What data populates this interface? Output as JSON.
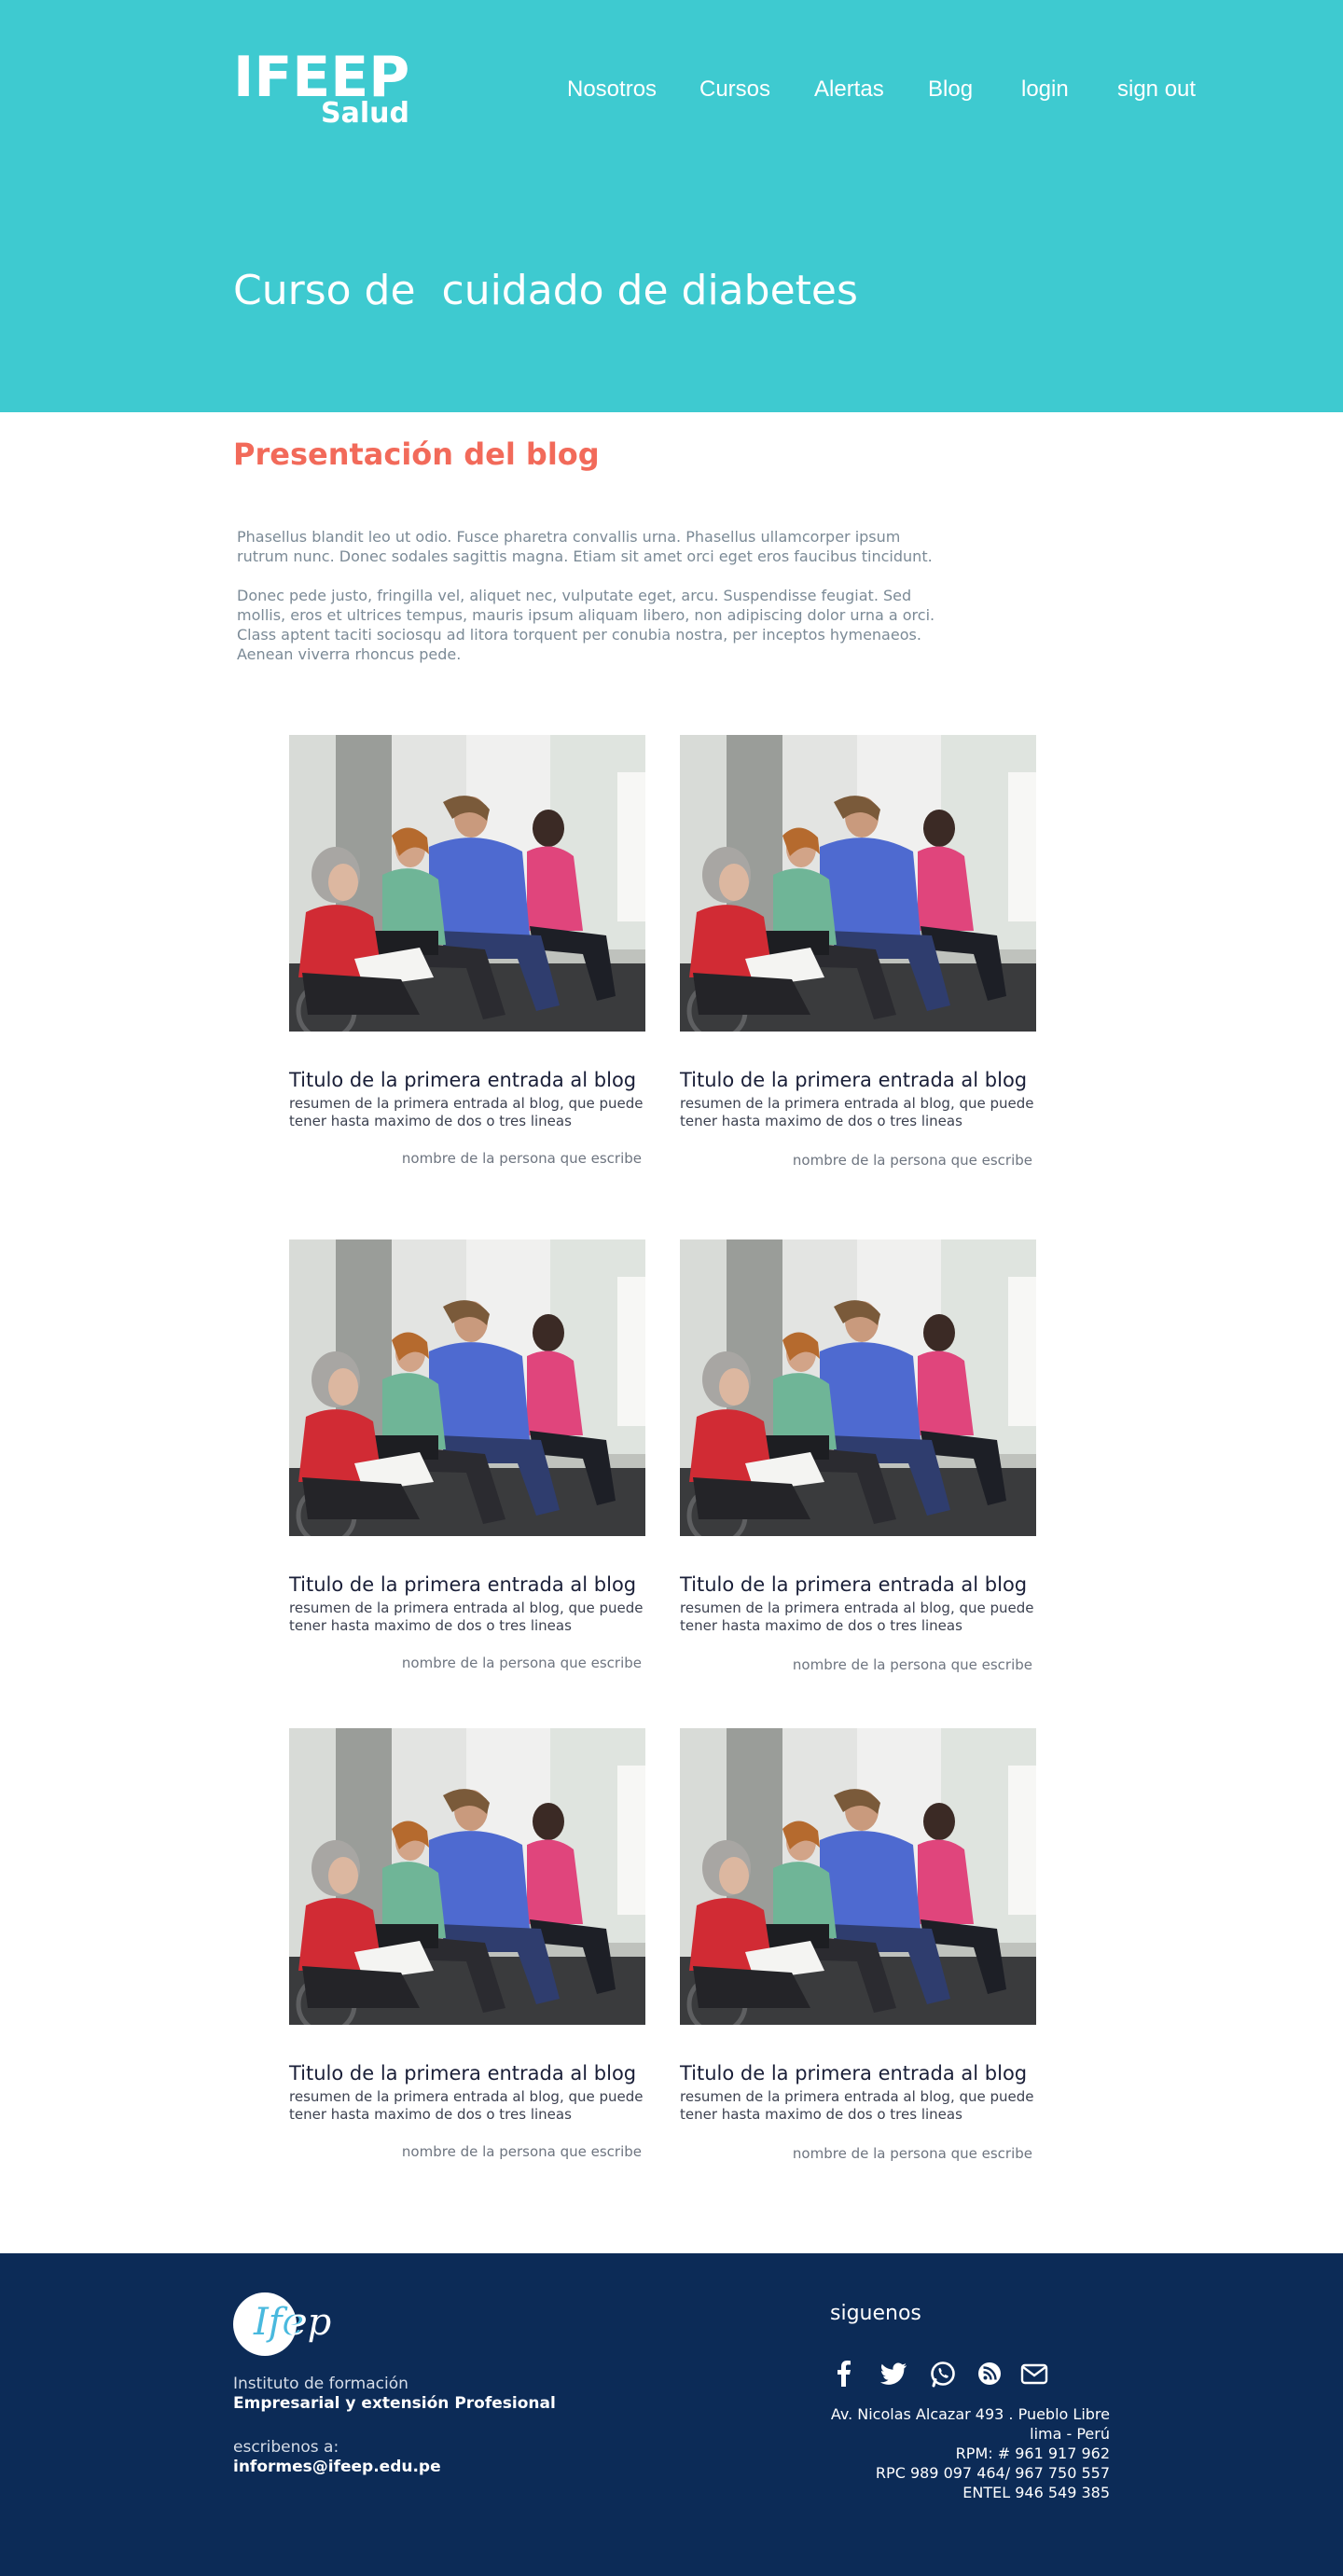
{
  "header": {
    "logo_main": "IFEEP",
    "logo_sub": "Salud",
    "nav": [
      "Nosotros",
      "Cursos",
      "Alertas",
      "Blog",
      "login",
      "sign out"
    ],
    "title": "Curso de  cuidado de diabetes"
  },
  "intro": {
    "heading": "Presentación del blog",
    "paragraph1": "Phasellus blandit leo ut odio. Fusce pharetra convallis urna. Phasellus ullamcorper ipsum rutrum nunc. Donec sodales sagittis magna. Etiam sit amet orci eget eros faucibus tincidunt.",
    "paragraph2": "Donec pede justo, fringilla vel, aliquet nec, vulputate eget, arcu. Suspendisse feugiat. Sed mollis, eros et ultrices tempus, mauris ipsum aliquam libero, non adipiscing dolor urna a orci. Class aptent taciti sociosqu ad litora torquent per conubia nostra, per inceptos hymenaeos. Aenean viverra rhoncus pede."
  },
  "posts": [
    {
      "title": "Titulo de la primera entrada al blog",
      "summary": "resumen de la primera entrada al blog, que puede tener hasta maximo de dos o tres lineas",
      "author": "nombre de la persona que escribe"
    },
    {
      "title": "Titulo de la primera entrada al blog",
      "summary": "resumen de la primera entrada al blog, que puede tener hasta maximo de dos o tres lineas",
      "author": "nombre de la persona que escribe"
    },
    {
      "title": "Titulo de la primera entrada al blog",
      "summary": "resumen de la primera entrada al blog, que puede tener hasta maximo de dos o tres lineas",
      "author": "nombre de la persona que escribe"
    },
    {
      "title": "Titulo de la primera entrada al blog",
      "summary": "resumen de la primera entrada al blog, que puede tener hasta maximo de dos o tres lineas",
      "author": "nombre de la persona que escribe"
    },
    {
      "title": "Titulo de la primera entrada al blog",
      "summary": "resumen de la primera entrada al blog, que puede tener hasta maximo de dos o tres lineas",
      "author": "nombre de la persona que escribe"
    },
    {
      "title": "Titulo de la primera entrada al blog",
      "summary": "resumen de la primera entrada al blog, que puede tener hasta maximo de dos o tres lineas",
      "author": "nombre de la persona que escribe"
    }
  ],
  "footer": {
    "logo_a": "Ife",
    "logo_b": "ep",
    "institute_line1": "Instituto de formación",
    "institute_line2": "Empresarial y extensión Profesional",
    "write_label": "escribenos a:",
    "email": "informes@ifeep.edu.pe",
    "follow_label": "siguenos",
    "social_icons": [
      "facebook-icon",
      "twitter-icon",
      "whatsapp-icon",
      "rss-icon",
      "mail-icon"
    ],
    "contact": [
      "Av. Nicolas Alcazar 493 . Pueblo Libre",
      "lima - Perú",
      "RPM: # 961 917 962",
      "RPC 989 097 464/ 967 750 557",
      "ENTEL 946 549 385"
    ]
  },
  "colors": {
    "hero": "#3ecad0",
    "heading_accent": "#f26a5a",
    "footer": "#0c2b57"
  }
}
